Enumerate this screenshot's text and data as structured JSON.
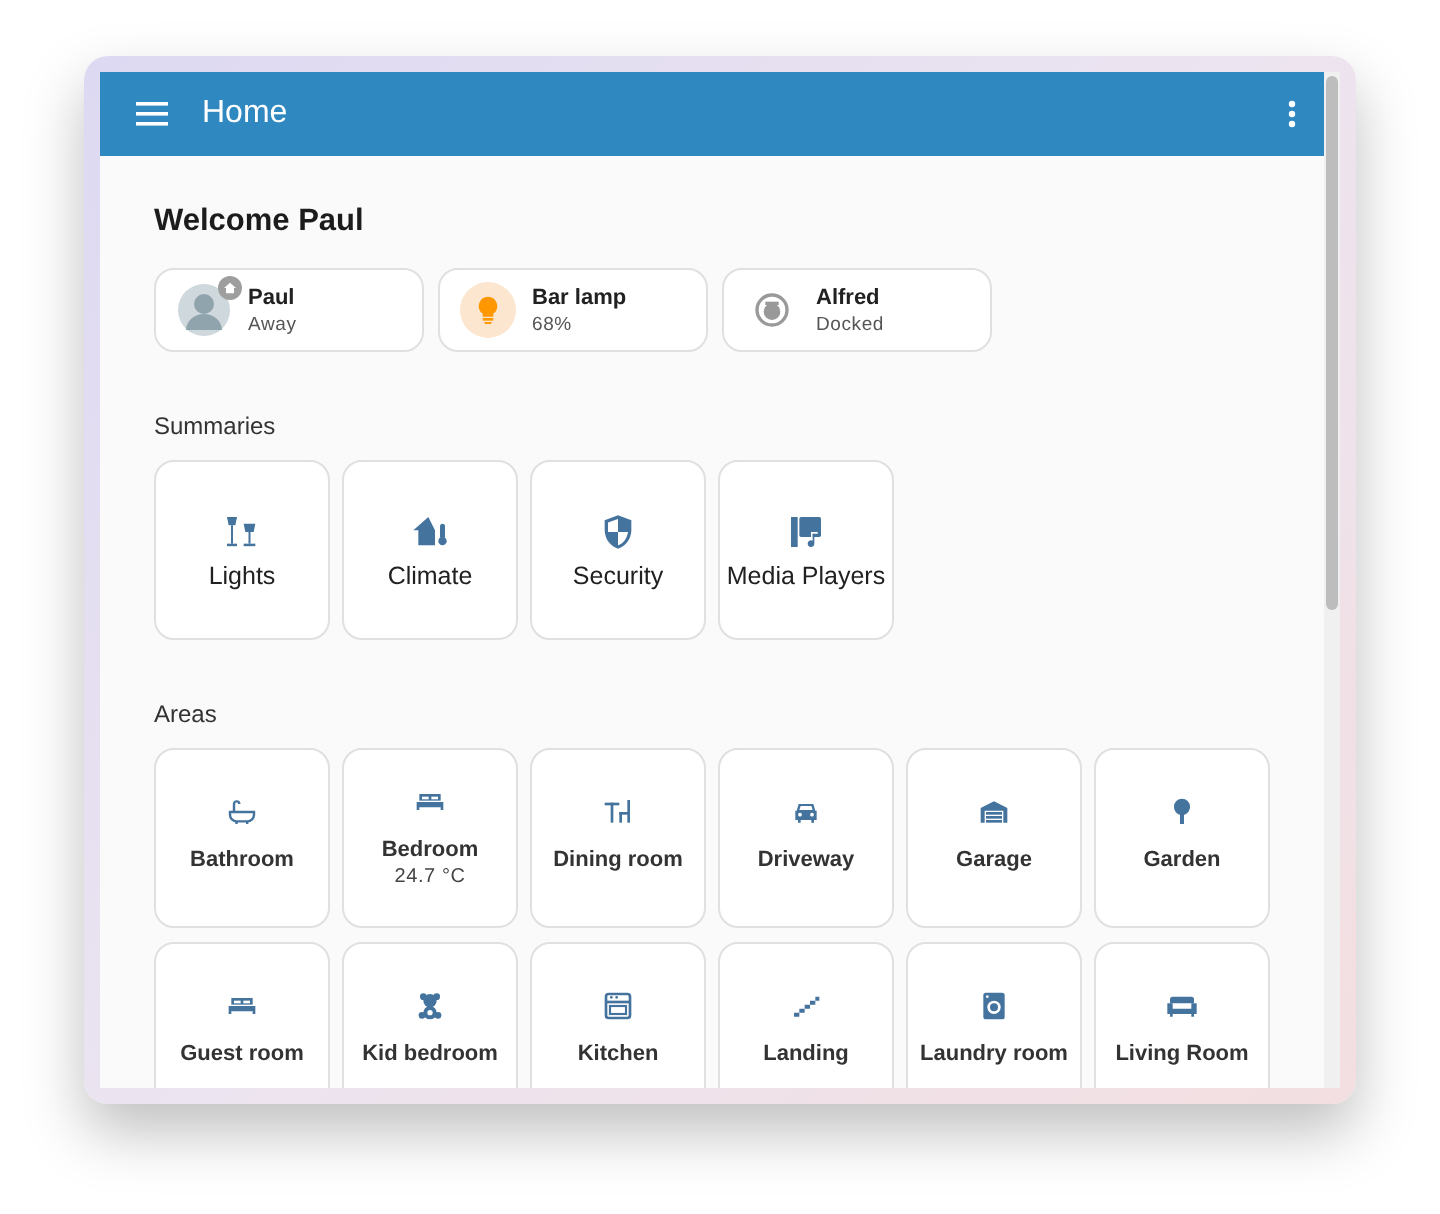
{
  "header": {
    "title": "Home"
  },
  "welcome": "Welcome Paul",
  "badges": [
    {
      "kind": "person",
      "name": "Paul",
      "state": "Away"
    },
    {
      "kind": "light",
      "name": "Bar lamp",
      "state": "68%",
      "on": true
    },
    {
      "kind": "vacuum",
      "name": "Alfred",
      "state": "Docked"
    }
  ],
  "summaries": {
    "heading": "Summaries",
    "items": [
      {
        "label": "Lights"
      },
      {
        "label": "Climate"
      },
      {
        "label": "Security"
      },
      {
        "label": "Media Players"
      }
    ]
  },
  "areas": {
    "heading": "Areas",
    "items": [
      {
        "name": "Bathroom"
      },
      {
        "name": "Bedroom",
        "sensor": "24.7 °C"
      },
      {
        "name": "Dining room"
      },
      {
        "name": "Driveway"
      },
      {
        "name": "Garage"
      },
      {
        "name": "Garden"
      },
      {
        "name": "Guest room"
      },
      {
        "name": "Kid bedroom"
      },
      {
        "name": "Kitchen"
      },
      {
        "name": "Landing"
      },
      {
        "name": "Laundry room"
      },
      {
        "name": "Living Room"
      }
    ]
  }
}
